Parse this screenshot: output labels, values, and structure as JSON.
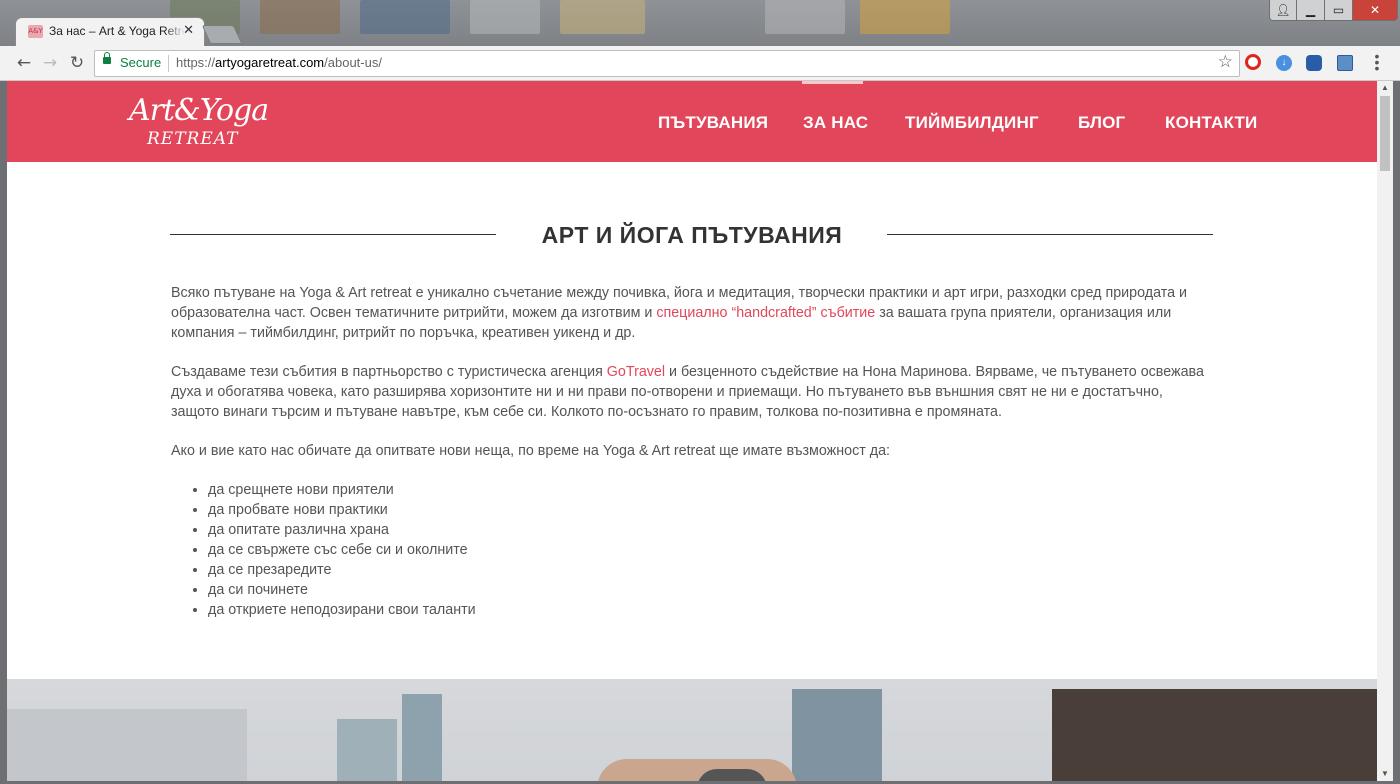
{
  "browser": {
    "tab_title": "За нас – Art & Yoga Retreat",
    "favicon_text": "A&Y",
    "secure_label": "Secure",
    "url_scheme": "https://",
    "url_host": "artyogaretreat.com",
    "url_path": "/about-us/",
    "icons": [
      "back-arrow-icon",
      "forward-arrow-icon",
      "reload-icon",
      "lock-icon",
      "bookmark-star-icon",
      "opera-extension-icon",
      "download-extension-icon",
      "settings-extension-icon",
      "window-extension-icon",
      "menu-dots-icon"
    ]
  },
  "site": {
    "logo_line1": "Art&Yoga",
    "logo_line2": "RETREAT",
    "nav": [
      "ПЪТУВАНИЯ",
      "ЗА НАС",
      "ТИЙМБИЛДИНГ",
      "БЛОГ",
      "КОНТАКТИ"
    ],
    "active_nav": "ЗА НАС",
    "header_color": "#e2465a"
  },
  "main": {
    "heading": "АРТ И ЙОГА ПЪТУВАНИЯ",
    "p1_before": "Всяко пътуване на Yoga & Art retreat е уникално съчетание между почивка, йога и медитация, творчески практики и арт игри, разходки сред природата и образователна част. Освен тематичните ритрийти, можем да изготвим и ",
    "p1_link": "специално “handcrafted” събитие",
    "p1_after": " за вашата група приятели, организация или компания – тиймбилдинг, ритрийт по поръчка, креативен уикенд и др.",
    "p2_before": "Създаваме тези събития в партньорство с туристическа агенция ",
    "p2_link": "GoTravel",
    "p2_after": " и безценното съдействие на Нона Маринова. Вярваме, че пътуването освежава духа и обогатява човека, като разширява хоризонтите ни и ни прави по-отворени и приемащи. Но пътуването във външния свят не ни е достатъчно, защото винаги търсим и пътуване навътре, към себе си. Колкото по-осъзнато го правим, толкова по-позитивна е промяната.",
    "p3": "Ако и вие като нас обичате да опитвате нови неща, по време на Yoga & Art retreat ще имате възможност да:",
    "list": [
      "да срещнете нови приятели",
      "да пробвате нови практики",
      "да опитате различна храна",
      "да се свържете със себе си и околните",
      "да се презаредите",
      "да си починете",
      "да откриете неподозирани свои таланти"
    ],
    "link_color": "#e2465a"
  }
}
